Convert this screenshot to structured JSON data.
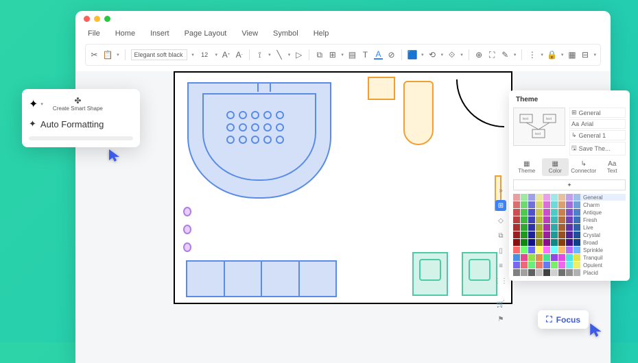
{
  "menu": {
    "file": "File",
    "home": "Home",
    "insert": "Insert",
    "page_layout": "Page Layout",
    "view": "View",
    "symbol": "Symbol",
    "help": "Help"
  },
  "toolbar": {
    "font_name": "Elegant soft black",
    "font_size": "12",
    "text_tool": "T"
  },
  "af": {
    "create": "Create Smart Shape",
    "label": "Auto Formatting"
  },
  "theme": {
    "title": "Theme",
    "general": "General",
    "font": "Arial",
    "line": "General 1",
    "save": "Save The...",
    "tabs": {
      "theme": "Theme",
      "color": "Color",
      "connector": "Connector",
      "text": "Text"
    },
    "add": "+",
    "presets": [
      "General",
      "Charm",
      "Antique",
      "Fresh",
      "Live",
      "Crystal",
      "Broad",
      "Sprinkle",
      "Tranquil",
      "Opulent",
      "Placid"
    ]
  },
  "focus": {
    "label": "Focus"
  },
  "icons": {
    "general": "⊞",
    "font_aa": "Aa",
    "line": "↳",
    "save": "🖫"
  },
  "palette_colors": [
    [
      "#e8a0a0",
      "#a0e8a0",
      "#a0a0e8",
      "#e8e8a0",
      "#e8a0e8",
      "#a0e8e8",
      "#e8c0a0",
      "#c0a0e8",
      "#a0c0e8"
    ],
    [
      "#d87070",
      "#70d870",
      "#7070d8",
      "#d8d870",
      "#d870d8",
      "#70d8d8",
      "#d8a070",
      "#a070d8",
      "#70a0d8"
    ],
    [
      "#c85050",
      "#50c850",
      "#5050c8",
      "#c8c850",
      "#c850c8",
      "#50c8c8",
      "#c88050",
      "#8050c8",
      "#5080c8"
    ],
    [
      "#b84040",
      "#40b840",
      "#4040b8",
      "#b8b840",
      "#b840b8",
      "#40b8b8",
      "#b87040",
      "#7040b8",
      "#4070b8"
    ],
    [
      "#a83030",
      "#30a830",
      "#3030a8",
      "#a8a830",
      "#a830a8",
      "#30a8a8",
      "#a86030",
      "#6030a8",
      "#3060a8"
    ],
    [
      "#982020",
      "#209820",
      "#202098",
      "#989820",
      "#982098",
      "#209898",
      "#985020",
      "#502098",
      "#205098"
    ],
    [
      "#881010",
      "#108810",
      "#101088",
      "#888810",
      "#881088",
      "#108888",
      "#884010",
      "#401088",
      "#104088"
    ],
    [
      "#ff6b6b",
      "#6bff6b",
      "#6b6bff",
      "#ffff6b",
      "#ff6bff",
      "#6bffff",
      "#ffb86b",
      "#b86bff",
      "#6bb8ff"
    ],
    [
      "#4a90e2",
      "#e24a90",
      "#90e24a",
      "#e2904a",
      "#4ae290",
      "#904ae2",
      "#e24ae2",
      "#4ae2e2",
      "#e2e24a"
    ],
    [
      "#7b68ee",
      "#ee687b",
      "#68ee7b",
      "#ee7b68",
      "#687bee",
      "#7bee68",
      "#ee68ee",
      "#68eeee",
      "#eeee68"
    ],
    [
      "#808080",
      "#a0a0a0",
      "#606060",
      "#c0c0c0",
      "#404040",
      "#d0d0d0",
      "#707070",
      "#909090",
      "#b0b0b0"
    ]
  ]
}
